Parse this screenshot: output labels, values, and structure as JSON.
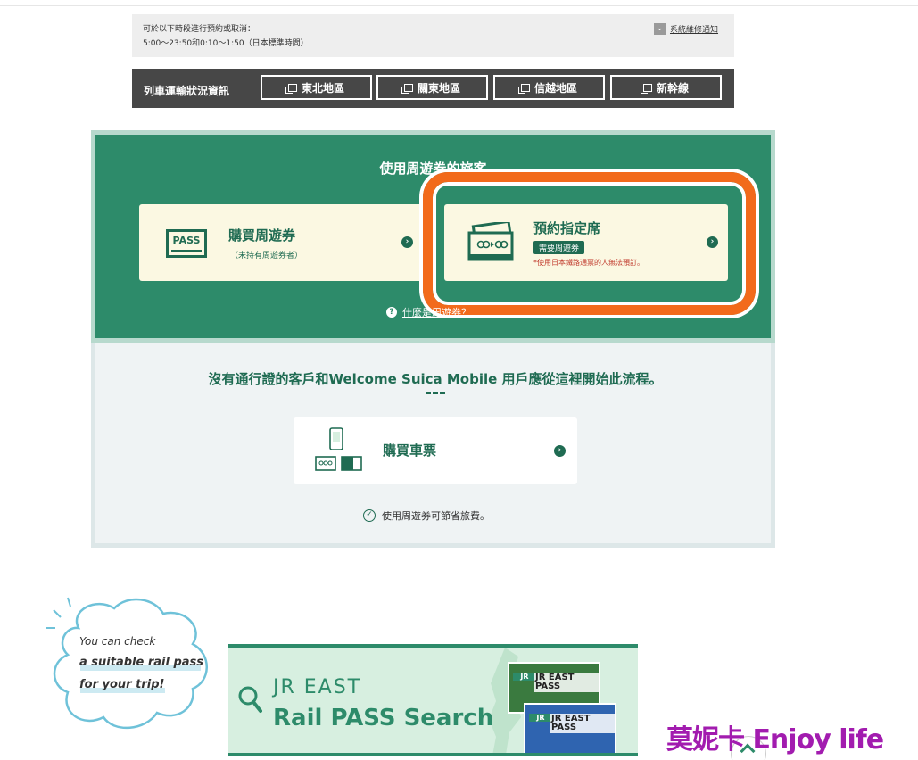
{
  "notice": {
    "line1": "可於以下時段進行預約或取消：",
    "line2": "5:00～23:50和0:10～1:50（日本標準時間）",
    "link_label": "系統維修通知"
  },
  "train_status": {
    "label": "列車運輸狀況資訊",
    "buttons": [
      "東北地區",
      "關東地區",
      "信越地區",
      "新幹線"
    ]
  },
  "pass_section": {
    "heading": "使用周遊券的旅客",
    "buy_pass": {
      "icon_text": "PASS",
      "title": "購買周遊券",
      "subtitle": "（未持有周遊券者）"
    },
    "reserve_seat": {
      "title": "預約指定席",
      "badge": "需要周遊券",
      "note": "*使用日本鐵路通票的人無法預訂。"
    },
    "what_is_link": "什麼是周遊券？",
    "highlight_color": "#f26a1b"
  },
  "ticket_section": {
    "heading": "沒有通行證的客戶和Welcome Suica Mobile 用戶應從這裡開始此流程。",
    "buy_ticket": {
      "title": "購買車票"
    },
    "saving_note": "使用周遊券可節省旅費。"
  },
  "bubble": {
    "line1": "You can check",
    "line2": "a suitable rail pass",
    "line3": "for your trip!"
  },
  "banner": {
    "line1": "JR EAST",
    "line2": "Rail PASS Search",
    "cover_brand": "JR EAST PASS"
  },
  "watermark": "莫妮卡 Enjoy life",
  "colors": {
    "primary": "#2d8b6a",
    "dark_green": "#1f6b52",
    "card_bg": "#fbf8e2"
  }
}
